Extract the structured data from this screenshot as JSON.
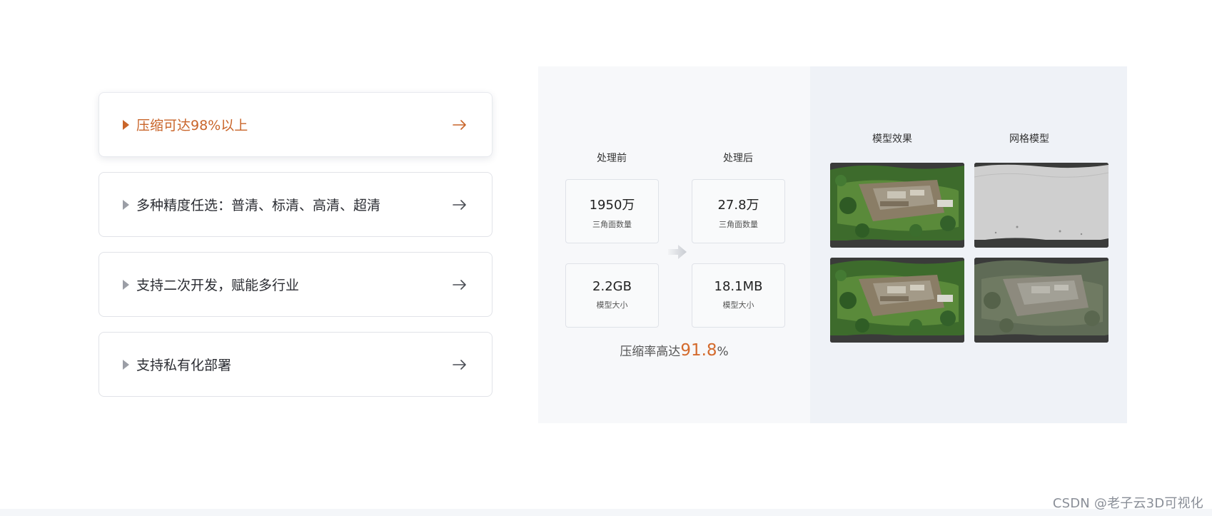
{
  "features": [
    {
      "label": "压缩可达98%以上",
      "active": true
    },
    {
      "label": "多种精度任选：普清、标清、高清、超清",
      "active": false
    },
    {
      "label": "支持二次开发，赋能多行业",
      "active": false
    },
    {
      "label": "支持私有化部署",
      "active": false
    }
  ],
  "comparison": {
    "before_title": "处理前",
    "after_title": "处理后",
    "before": {
      "faces_value": "1950万",
      "faces_label": "三角面数量",
      "size_value": "2.2GB",
      "size_label": "模型大小"
    },
    "after": {
      "faces_value": "27.8万",
      "faces_label": "三角面数量",
      "size_value": "18.1MB",
      "size_label": "模型大小"
    },
    "ratio_prefix": "压缩率高达",
    "ratio_value": "91.8",
    "ratio_suffix": "%"
  },
  "images": {
    "effect_title": "模型效果",
    "mesh_title": "网格模型"
  },
  "watermark": "CSDN @老子云3D可视化",
  "colors": {
    "accent": "#c9652a",
    "highlight": "#d46a2c",
    "panel_left_bg": "#f7f8fa",
    "panel_right_bg": "#eff2f7"
  }
}
